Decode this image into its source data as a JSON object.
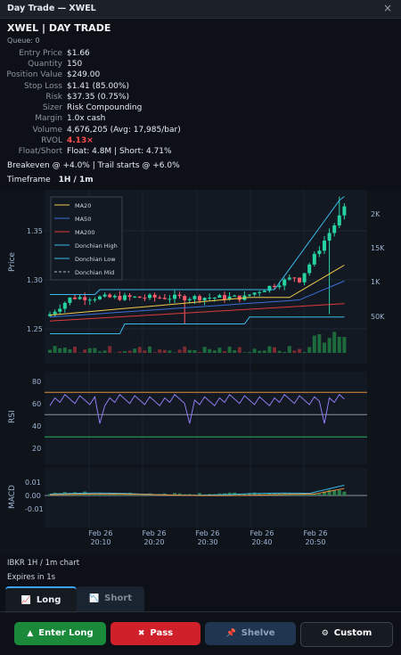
{
  "window": {
    "title": "Day Trade — XWEL",
    "close_icon": "×"
  },
  "header": {
    "title": "XWEL  |  DAY TRADE",
    "queue": "Queue: 0"
  },
  "info_rows": [
    {
      "label": "Entry Price",
      "value": "$1.66"
    },
    {
      "label": "Quantity",
      "value": "150"
    },
    {
      "label": "Position Value",
      "value": "$249.00"
    },
    {
      "label": "Stop Loss",
      "value": "$1.41 (85.00%)"
    },
    {
      "label": "Risk",
      "value": "$37.35 (0.75%)"
    },
    {
      "label": "Sizer",
      "value": "Risk Compounding"
    },
    {
      "label": "Margin",
      "value": "1.0x cash"
    },
    {
      "label": "Volume",
      "value": "4,676,205 (Avg: 17,985/bar)"
    },
    {
      "label": "RVOL",
      "value": "4.13×"
    },
    {
      "label": "Float/Short",
      "value": "Float: 4.8M  |  Short: 4.71%"
    }
  ],
  "breakeven": "Breakeven @ +4.0%  |  Trail starts @ +6.0%",
  "timeframe": {
    "label": "Timeframe",
    "value": "1H / 1m"
  },
  "chart_data": {
    "type": "candlestick",
    "ylabel_price": "Price",
    "price_ticks": [
      "1.35",
      "1.30",
      "1.25"
    ],
    "volume_ticks": [
      "2K",
      "15K",
      "1K",
      "50K"
    ],
    "legend": [
      "MA20",
      "MA50",
      "MA200",
      "Donchian High",
      "Donchian Low",
      "Donchian Mid"
    ],
    "rsi": {
      "label": "RSI",
      "ticks": [
        "80",
        "60",
        "40",
        "20"
      ],
      "overbought": 70,
      "oversold": 30,
      "mid": 50
    },
    "macd": {
      "label": "MACD",
      "ticks": [
        "0.01",
        "0.00",
        "-0.01"
      ]
    },
    "x_ticks": [
      {
        "date": "Feb 26",
        "time": "20:10"
      },
      {
        "date": "Feb 26",
        "time": "20:20"
      },
      {
        "date": "Feb 26",
        "time": "20:30"
      },
      {
        "date": "Feb 26",
        "time": "20:40"
      },
      {
        "date": "Feb 26",
        "time": "20:50"
      }
    ],
    "colors": {
      "up": "#26d3a0",
      "down": "#ff5a6a",
      "ma20": "#f2c94c",
      "ma50": "#3b6fd6",
      "ma200": "#e03a3a",
      "donchian": "#3ab9e8"
    }
  },
  "footer": {
    "source": "IBKR 1H / 1m chart",
    "expires": "Expires in 1s"
  },
  "tabs": [
    {
      "label": "Long",
      "icon": "📈"
    },
    {
      "label": "Short",
      "icon": "📉"
    }
  ],
  "buttons": {
    "enter_long": "Enter Long",
    "pass": "Pass",
    "shelve": "Shelve",
    "custom": "Custom"
  }
}
